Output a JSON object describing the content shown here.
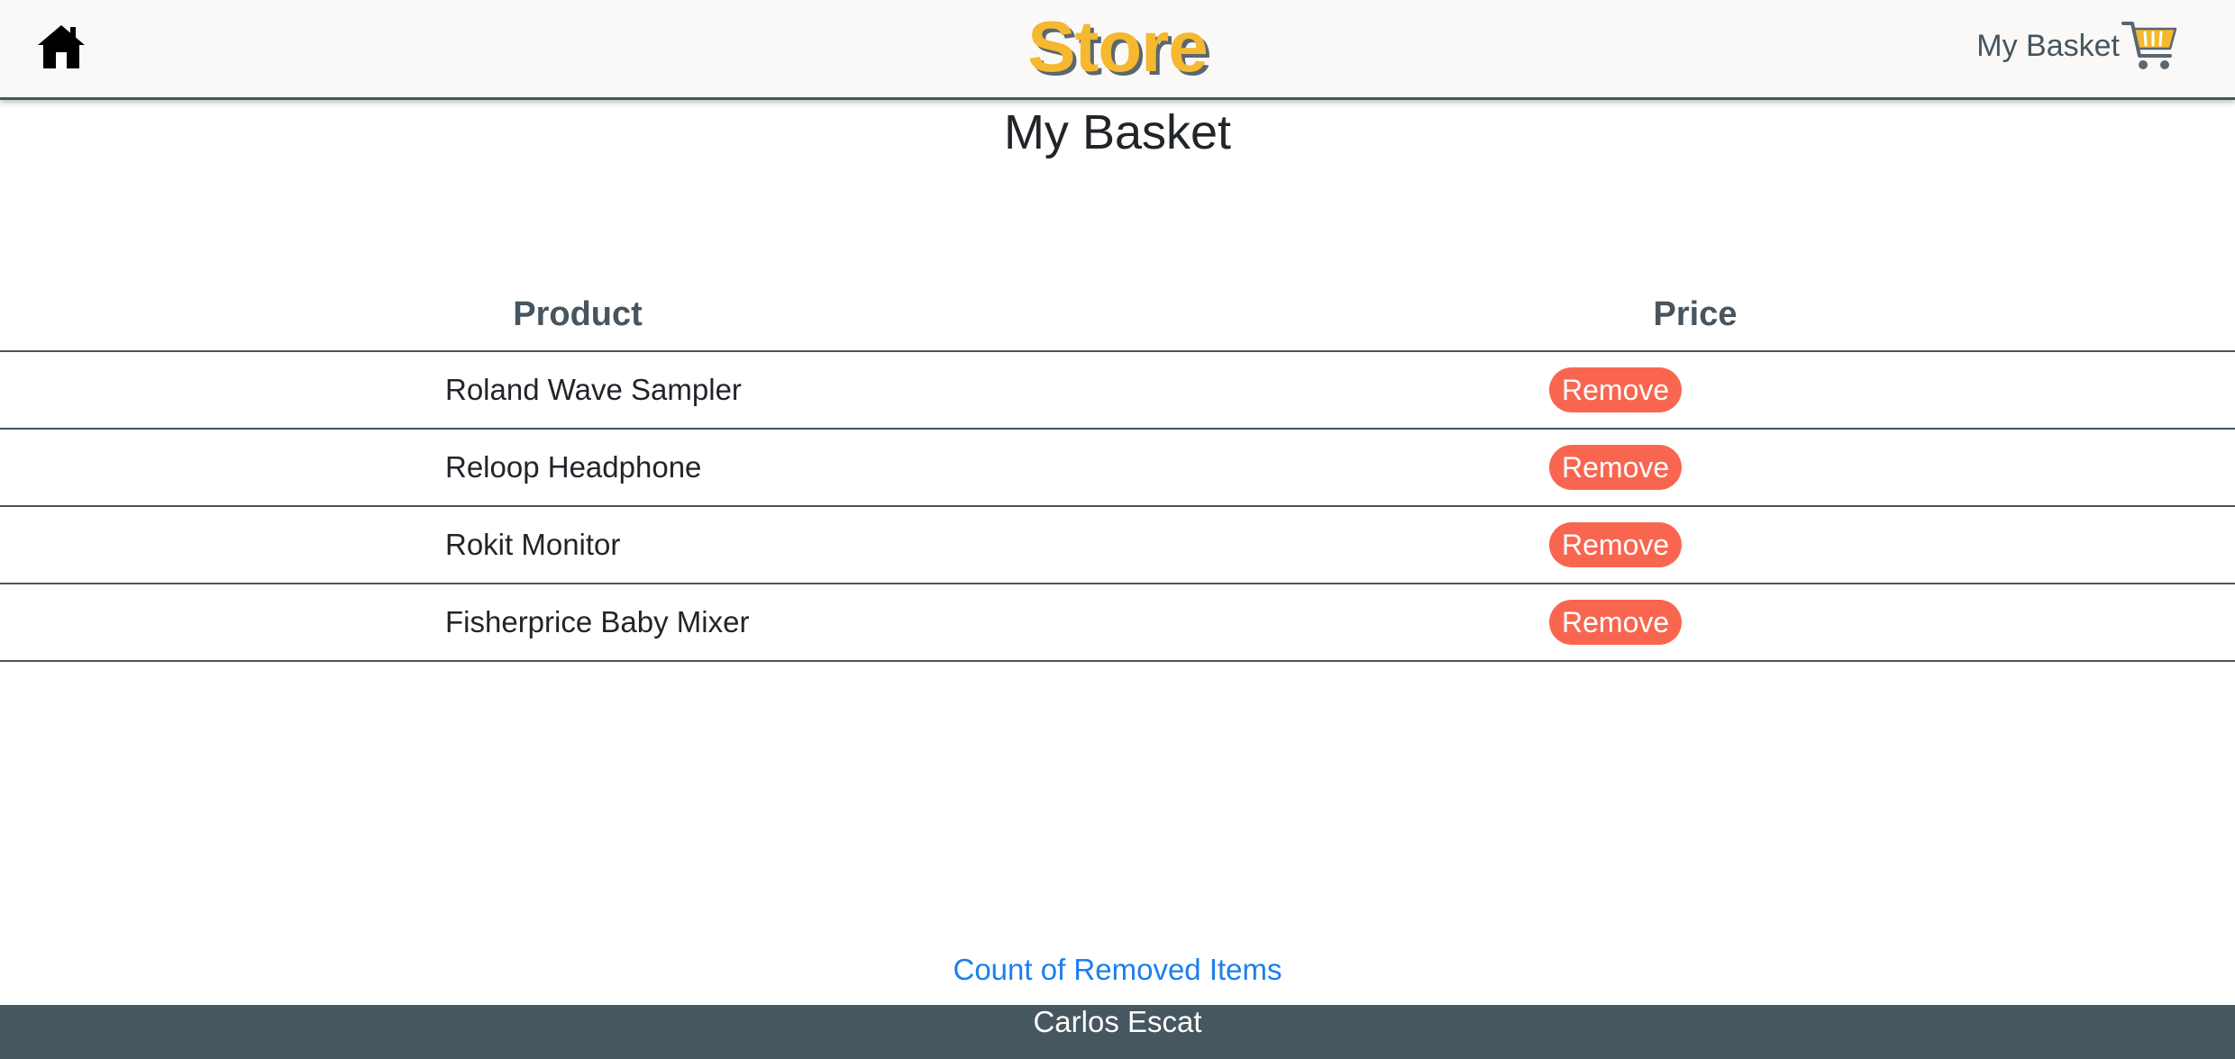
{
  "header": {
    "brand": "Store",
    "basket_label": "My Basket",
    "home_icon": "home-icon",
    "cart_icon": "shopping-cart-icon",
    "colors": {
      "brand": "#f5b82e",
      "navbar_border": "#46555f"
    }
  },
  "page": {
    "title": "My Basket"
  },
  "table": {
    "headers": {
      "product": "Product",
      "price": "Price"
    },
    "rows": [
      {
        "product": "Roland Wave Sampler",
        "action": "Remove"
      },
      {
        "product": "Reloop Headphone",
        "action": "Remove"
      },
      {
        "product": "Rokit Monitor",
        "action": "Remove"
      },
      {
        "product": "Fisherprice Baby Mixer",
        "action": "Remove"
      }
    ],
    "colors": {
      "remove_button": "#f96650"
    }
  },
  "removed": {
    "label": "Count of Removed Items"
  },
  "footer": {
    "author": "Carlos Escat",
    "background": "#46575f"
  }
}
